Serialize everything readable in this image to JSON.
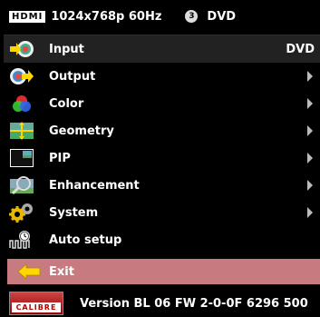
{
  "header": {
    "hdmi_badge": "HDMI",
    "signal": "1024x768p 60Hz",
    "source_number": "3",
    "source_label": "DVD"
  },
  "menu": {
    "items": [
      {
        "label": "Input",
        "value": "DVD",
        "icon": "input-icon"
      },
      {
        "label": "Output",
        "icon": "output-icon"
      },
      {
        "label": "Color",
        "icon": "color-icon"
      },
      {
        "label": "Geometry",
        "icon": "geometry-icon"
      },
      {
        "label": "PIP",
        "icon": "pip-icon"
      },
      {
        "label": "Enhancement",
        "icon": "enhancement-icon"
      },
      {
        "label": "System",
        "icon": "system-icon"
      },
      {
        "label": "Auto setup",
        "icon": "auto-setup-icon"
      }
    ],
    "exit_label": "Exit"
  },
  "footer": {
    "logo_text": "CALIBRE",
    "version": "Version BL 06 FW 2-0-0F  6296 500"
  },
  "colors": {
    "background": "#000000",
    "exit_highlight": "#c77b80",
    "arrow": "#bbbbbb"
  }
}
